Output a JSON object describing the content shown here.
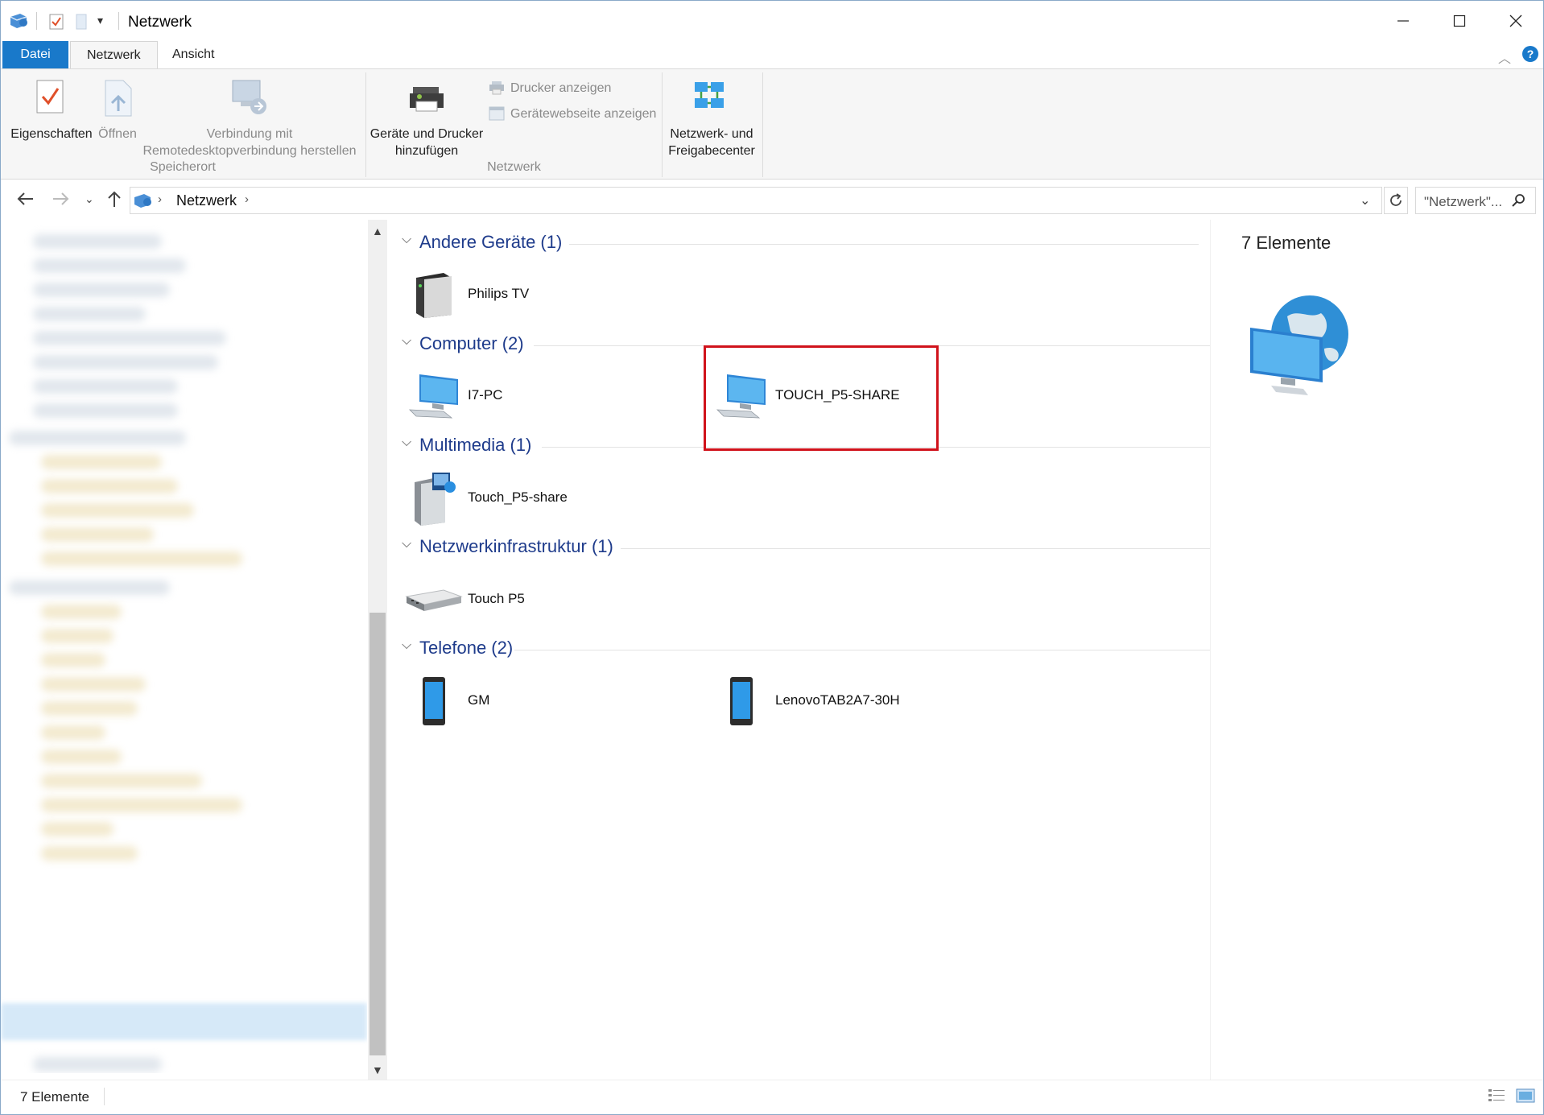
{
  "window": {
    "title": "Netzwerk"
  },
  "ribbon": {
    "tabs": [
      "Datei",
      "Netzwerk",
      "Ansicht"
    ],
    "buttons": {
      "eigenschaften": "Eigenschaften",
      "oeffnen": "Öffnen",
      "verbindung_line1": "Verbindung mit",
      "verbindung_line2": "Remotedesktopverbindung herstellen",
      "geraete_line1": "Geräte und Drucker",
      "geraete_line2": "hinzufügen",
      "drucker_anzeigen": "Drucker anzeigen",
      "geraetewebseite": "Gerätewebseite anzeigen",
      "netzwerk_line1": "Netzwerk- und",
      "netzwerk_line2": "Freigabecenter"
    },
    "groups": {
      "speicherort": "Speicherort",
      "netzwerk": "Netzwerk"
    }
  },
  "address": {
    "path": "Netzwerk",
    "search_placeholder": "\"Netzwerk\"..."
  },
  "groups": [
    {
      "label": "Andere Geräte (1)",
      "items": [
        {
          "name": "Philips TV",
          "icon": "media-server-icon"
        }
      ]
    },
    {
      "label": "Computer (2)",
      "items": [
        {
          "name": "I7-PC",
          "icon": "computer-icon"
        },
        {
          "name": "TOUCH_P5-SHARE",
          "icon": "computer-icon"
        }
      ]
    },
    {
      "label": "Multimedia (1)",
      "items": [
        {
          "name": "Touch_P5-share",
          "icon": "media-device-icon"
        }
      ]
    },
    {
      "label": "Netzwerkinfrastruktur (1)",
      "items": [
        {
          "name": "Touch P5",
          "icon": "router-icon"
        }
      ]
    },
    {
      "label": "Telefone (2)",
      "items": [
        {
          "name": "GM",
          "icon": "phone-icon"
        },
        {
          "name": "LenovoTAB2A7-30H",
          "icon": "phone-icon"
        }
      ]
    }
  ],
  "details": {
    "count": "7 Elemente"
  },
  "status": {
    "count": "7 Elemente"
  },
  "colors": {
    "accent": "#1979ca",
    "group_header": "#1e3b8b",
    "highlight": "#d0121b"
  }
}
